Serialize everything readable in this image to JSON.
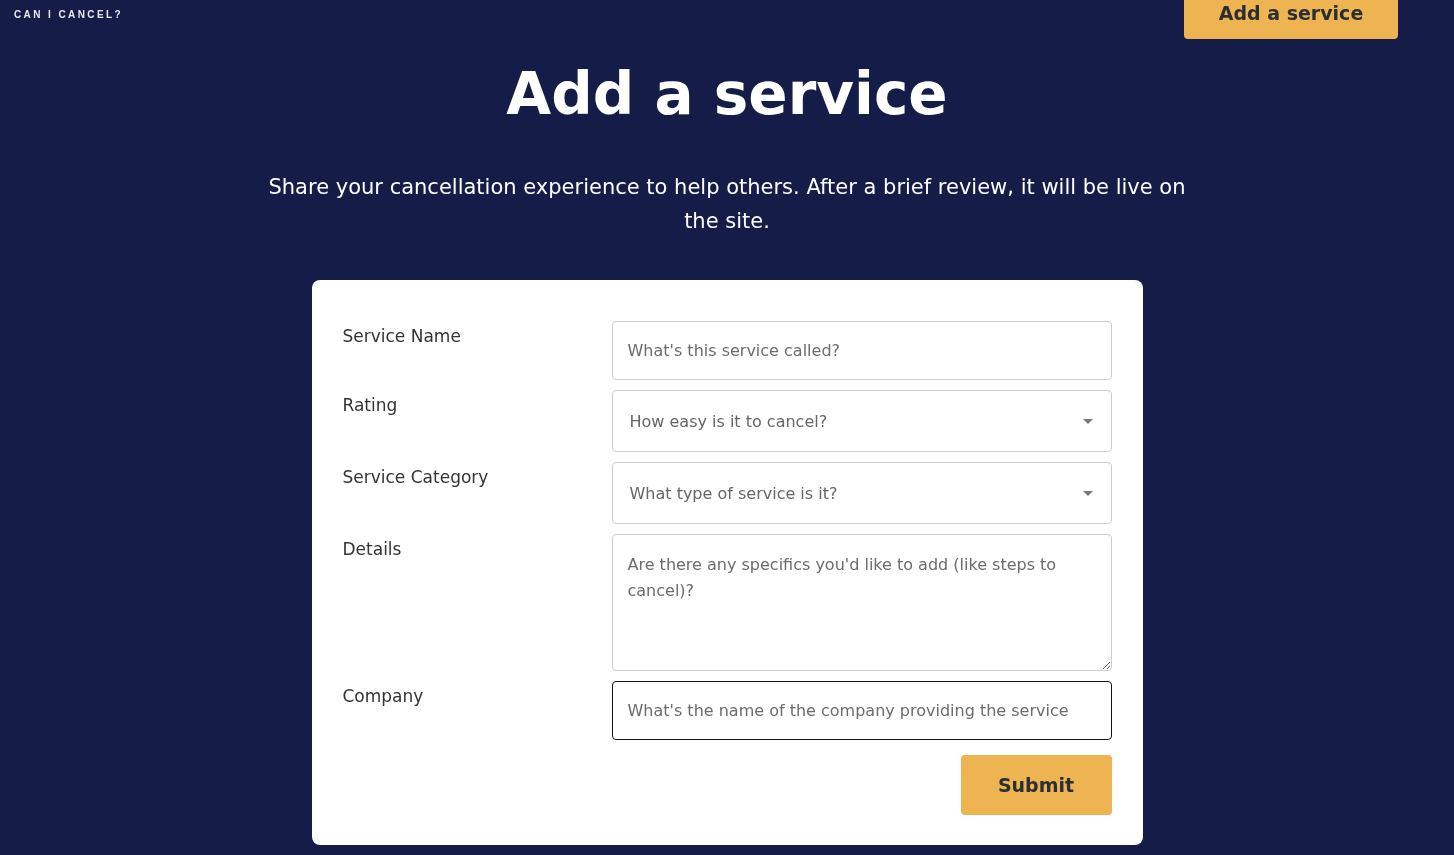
{
  "header": {
    "logo": "CAN I CANCEL?",
    "button": "Add a service"
  },
  "title": "Add a service",
  "subtitle": "Share your cancellation experience to help others. After a brief review, it will be live on the site.",
  "form": {
    "fields": [
      {
        "label": "Service Name",
        "kind": "text",
        "placeholder": "What's this service called?",
        "focused": false
      },
      {
        "label": "Rating",
        "kind": "select",
        "placeholder": "How easy is it to cancel?",
        "focused": false
      },
      {
        "label": "Service Category",
        "kind": "select",
        "placeholder": "What type of service is it?",
        "focused": false
      },
      {
        "label": "Details",
        "kind": "textarea",
        "placeholder": "Are there any specifics you'd like to add (like steps to cancel)?",
        "focused": false
      },
      {
        "label": "Company",
        "kind": "text",
        "placeholder": "What's the name of the company providing the service",
        "focused": true
      }
    ],
    "submit": "Submit"
  }
}
